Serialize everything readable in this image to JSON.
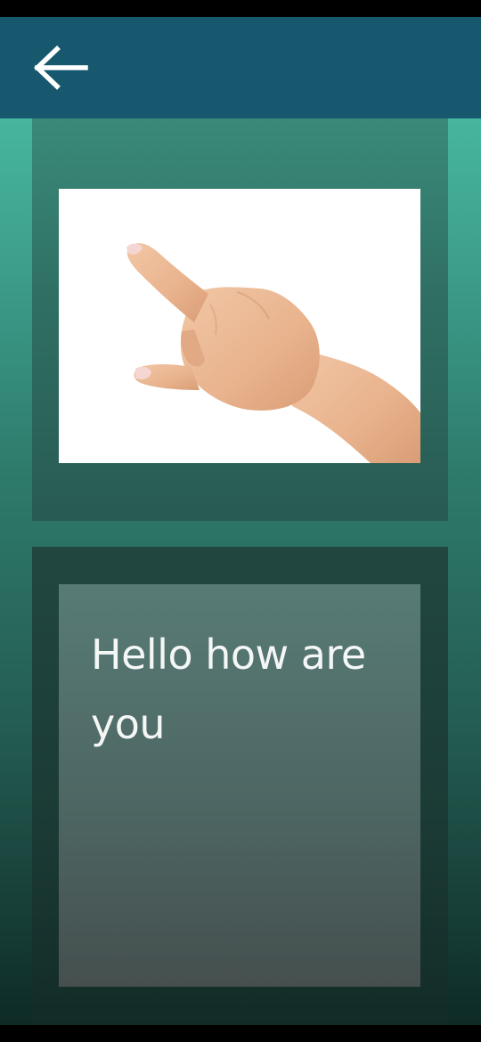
{
  "header": {
    "back_icon": "arrow-left-icon",
    "background_color": "#17586f"
  },
  "image_card": {
    "image_subject": "hand-pointing-finger",
    "background_color": "#ffffff"
  },
  "text_card": {
    "message": "Hello how are you"
  },
  "colors": {
    "accent_top": "#4ec6ab",
    "accent_bottom": "#0e2a26",
    "text": "#f4f7f6"
  }
}
